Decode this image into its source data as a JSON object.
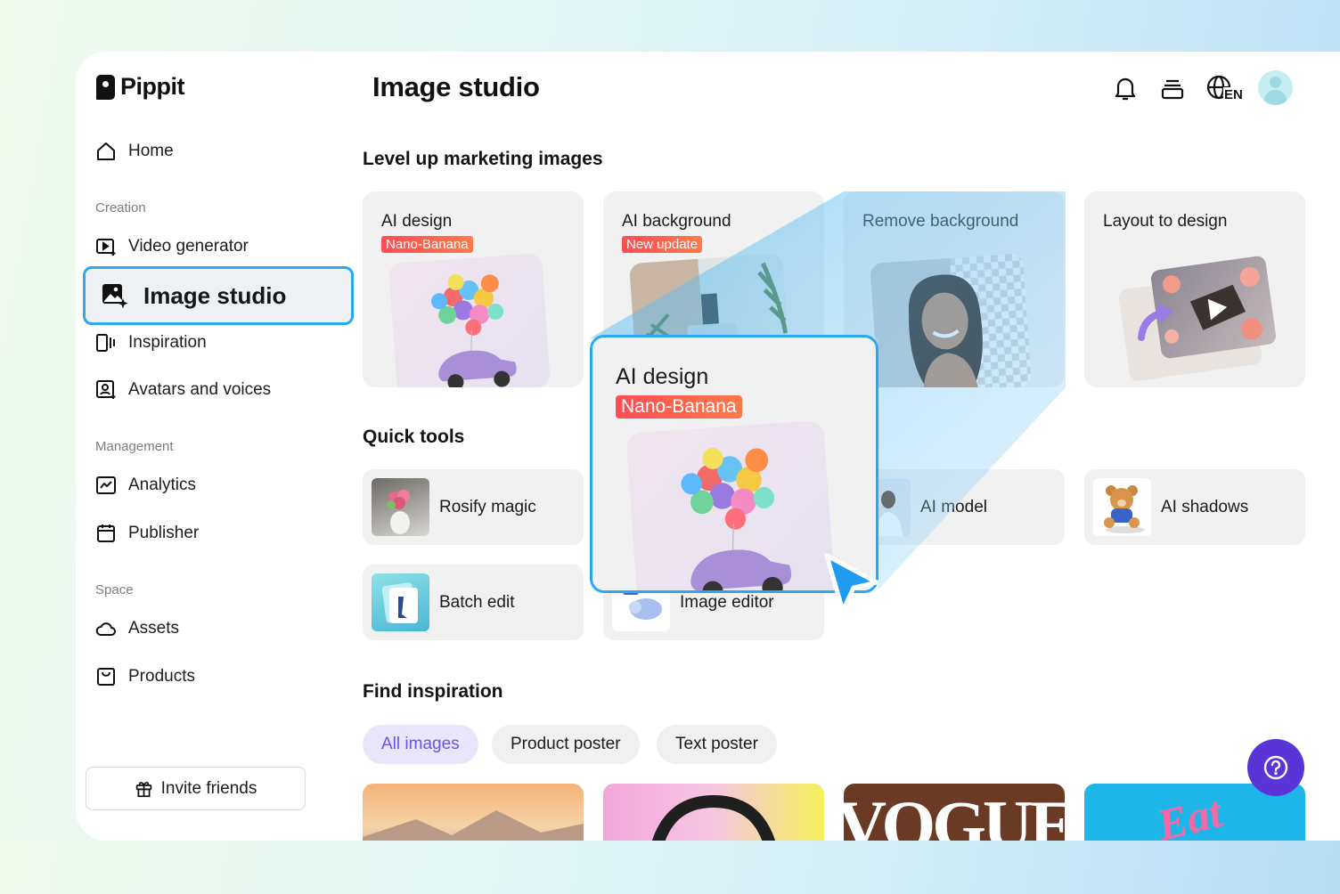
{
  "app": {
    "name": "Pippit"
  },
  "sidebar": {
    "home": "Home",
    "sections": {
      "creation": "Creation",
      "management": "Management",
      "space": "Space"
    },
    "items": {
      "video_generator": "Video generator",
      "image_studio": "Image studio",
      "inspiration": "Inspiration",
      "avatars": "Avatars and voices",
      "analytics": "Analytics",
      "publisher": "Publisher",
      "assets": "Assets",
      "products": "Products"
    },
    "invite": "Invite friends"
  },
  "header": {
    "title": "Image studio",
    "icons": [
      "bell-icon",
      "stack-icon",
      "language-icon",
      "avatar"
    ],
    "language_code": "EN"
  },
  "marketing": {
    "title": "Level up marketing images",
    "cards": [
      {
        "title": "AI design",
        "badge": "Nano-Banana"
      },
      {
        "title": "AI background",
        "badge": "New update"
      },
      {
        "title": "Remove background",
        "badge": ""
      },
      {
        "title": "Layout to design",
        "badge": ""
      }
    ]
  },
  "quick_tools": {
    "title": "Quick tools",
    "tools": [
      "Rosify magic",
      "AI model",
      "AI shadows",
      "Batch edit",
      "Image editor"
    ]
  },
  "zoom": {
    "title": "AI design",
    "badge": "Nano-Banana"
  },
  "inspiration": {
    "title": "Find inspiration",
    "chips": [
      "All images",
      "Product poster",
      "Text poster"
    ],
    "active_chip": "All images",
    "thumb_texts": {
      "vogue": "VOGUE",
      "eat": "Eat"
    }
  },
  "colors": {
    "accent_blue": "#2aa8f0",
    "badge_red": "#ff4c55",
    "help_purple": "#5b34d8",
    "chip_active_text": "#6a53e6"
  }
}
